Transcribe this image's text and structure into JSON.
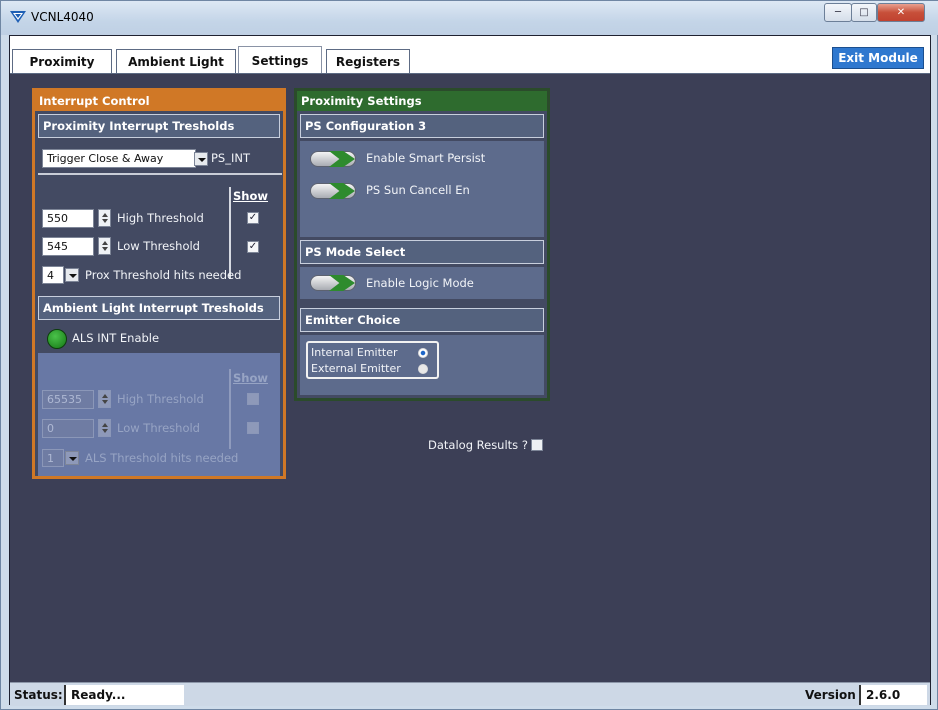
{
  "window": {
    "title": "VCNL4040"
  },
  "tabs": [
    {
      "label": "Proximity"
    },
    {
      "label": "Ambient Light"
    },
    {
      "label": "Settings"
    },
    {
      "label": "Registers"
    }
  ],
  "exit_button": {
    "label": "Exit Module"
  },
  "interrupt_control": {
    "title": "Interrupt Control",
    "prox": {
      "title": "Proximity Interrupt Tresholds",
      "mode_value": "Trigger Close & Away",
      "mode_suffix": "PS_INT",
      "show_label": "Show",
      "high_value": "550",
      "high_label": "High Threshold",
      "low_value": "545",
      "low_label": "Low Threshold",
      "hits_value": "4",
      "hits_label": "Prox Threshold hits needed",
      "high_show_checked": true,
      "low_show_checked": true
    },
    "als": {
      "title": "Ambient Light Interrupt Tresholds",
      "enable_label": "ALS INT Enable",
      "show_label": "Show",
      "high_value": "65535",
      "high_label": "High Threshold",
      "low_value": "0",
      "low_label": "Low Threshold",
      "hits_value": "1",
      "hits_label": "ALS Threshold hits needed"
    }
  },
  "proximity_settings": {
    "title": "Proximity  Settings",
    "ps_config3": {
      "title": "PS Configuration 3",
      "smart_persist_label": "Enable Smart Persist",
      "sun_cancel_label": "PS Sun Cancell En"
    },
    "ps_mode": {
      "title": "PS Mode Select",
      "logic_mode_label": "Enable Logic Mode"
    },
    "emitter": {
      "title": "Emitter Choice",
      "internal_label": "Internal Emitter",
      "external_label": "External Emitter",
      "selected": "Internal Emitter"
    }
  },
  "datalog": {
    "label": "Datalog Results ?"
  },
  "status": {
    "label": "Status:",
    "value": "Ready...",
    "version_label": "Version",
    "version_value": "2.6.0"
  },
  "colors": {
    "accent_orange": "#d07826",
    "accent_green": "#2e6b2e",
    "background": "#3c3f56",
    "exit_blue": "#2f78cf"
  }
}
